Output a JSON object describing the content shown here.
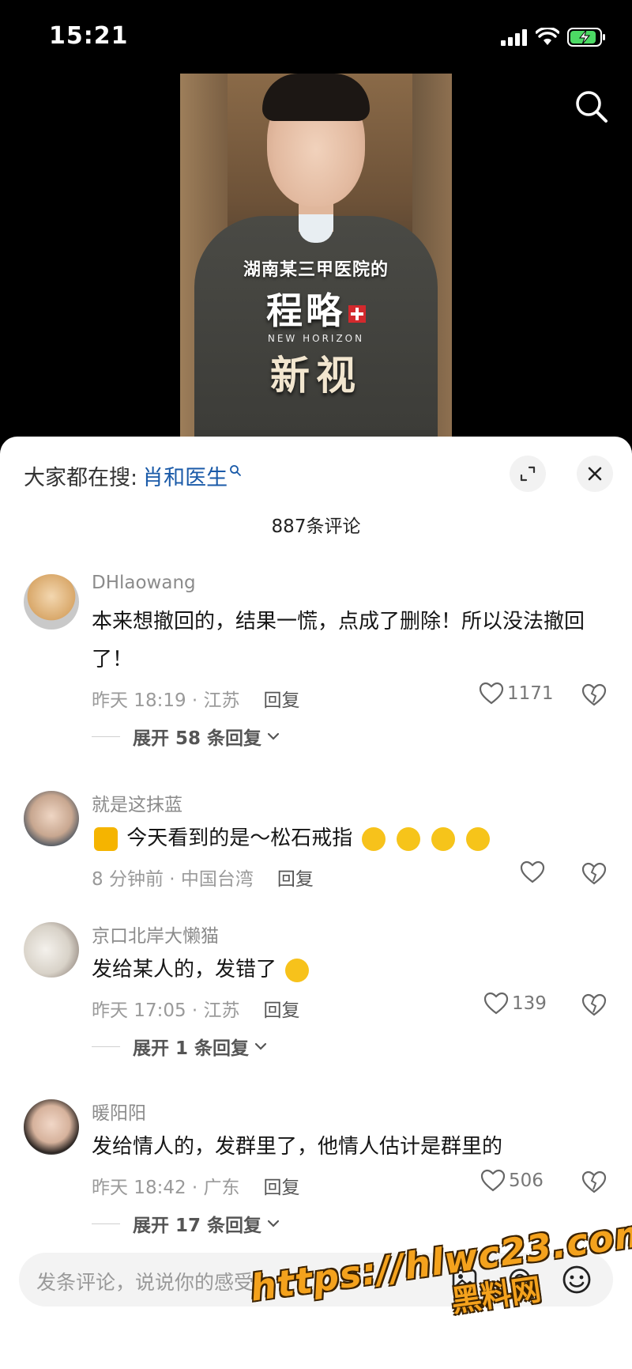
{
  "status_bar": {
    "time": "15:21"
  },
  "video": {
    "subtitle": "湖南某三甲医院的",
    "logo_line1": "程略",
    "logo_en": "NEW HORIZON",
    "logo_line2": "新视"
  },
  "sheet": {
    "hot_search_label": "大家都在搜:",
    "hot_search_term": "肖和医生",
    "comment_count": "887条评论"
  },
  "comments": [
    {
      "user": "DHlaowang",
      "text": "本来想撤回的，结果一慌，点成了删除！所以没法撤回了！",
      "time": "昨天 18:19 · 江苏",
      "reply": "回复",
      "likes": "1171",
      "expand": "展开 58 条回复"
    },
    {
      "user": "就是这抹蓝",
      "text": "今天看到的是～松石戒指",
      "time": "8 分钟前 · 中国台湾",
      "reply": "回复",
      "likes": "",
      "expand": ""
    },
    {
      "user": "京口北岸大懒猫",
      "text": "发给某人的，发错了",
      "time": "昨天 17:05 · 江苏",
      "reply": "回复",
      "likes": "139",
      "expand": "展开 1 条回复"
    },
    {
      "user": "暖阳阳",
      "text": "发给情人的，发群里了，他情人估计是群里的",
      "time": "昨天 18:42 · 广东",
      "reply": "回复",
      "likes": "506",
      "expand": "展开 17 条回复"
    }
  ],
  "input": {
    "placeholder": "发条评论，说说你的感受"
  },
  "watermark": {
    "url": "https://hlwc23.com",
    "name": "黑料网"
  },
  "colors": {
    "accent_link": "#1a5aa8",
    "watermark": "#f4a21d"
  }
}
